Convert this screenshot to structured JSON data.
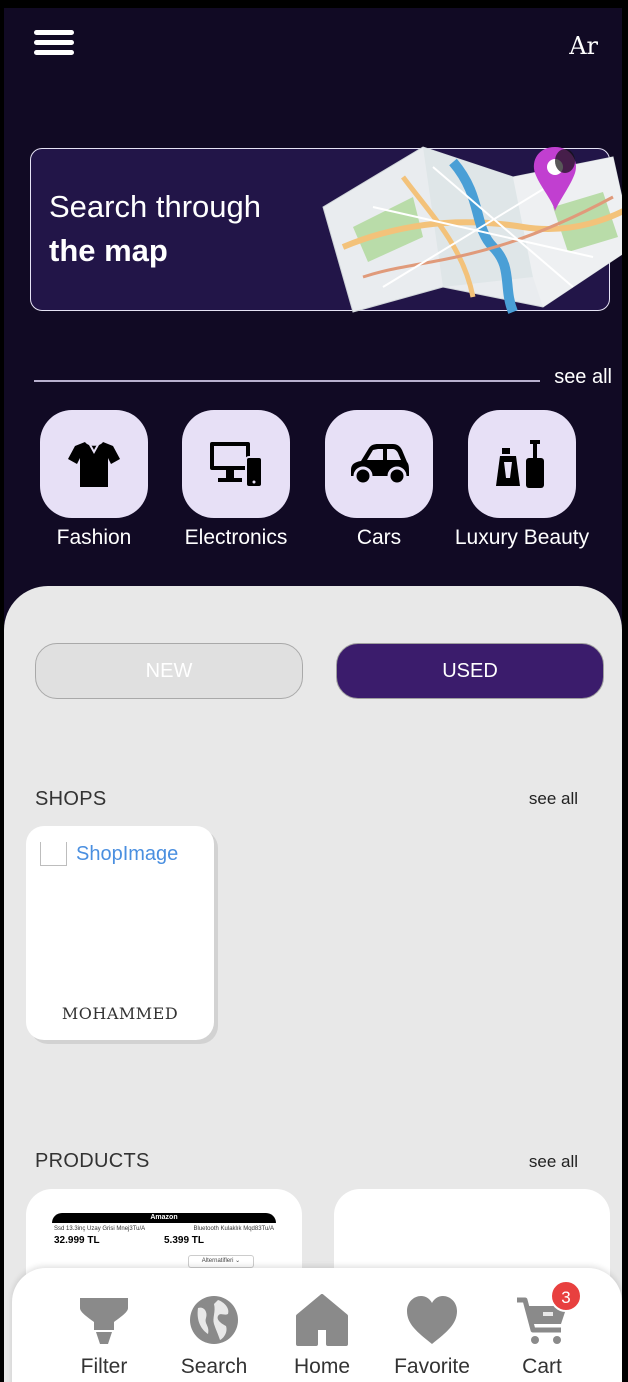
{
  "header": {
    "language_label": "Ar"
  },
  "map_banner": {
    "line1": "Search through",
    "line2": "the map"
  },
  "categories": {
    "see_all": "see all",
    "items": [
      {
        "label": "Fashion",
        "icon": "shirt-icon"
      },
      {
        "label": "Electronics",
        "icon": "devices-icon"
      },
      {
        "label": "Cars",
        "icon": "car-icon"
      },
      {
        "label": "Luxury Beauty",
        "icon": "perfume-icon"
      }
    ]
  },
  "condition_toggle": {
    "new_label": "NEW",
    "used_label": "USED",
    "selected": "USED"
  },
  "shops": {
    "title": "SHOPS",
    "see_all": "see all",
    "items": [
      {
        "image_alt": "ShopImage",
        "name": "MOHAMMED"
      }
    ]
  },
  "products": {
    "title": "PRODUCTS",
    "see_all": "see all",
    "items": [
      {
        "thumb_header": "Amazon",
        "thumb_name_1": "Ssd 13.3inç Uzay Grisi Mnej3Tu/A",
        "thumb_name_2": "Bluetooth Kulaklık Mqd83Tu/A",
        "thumb_price_1": "32.999 TL",
        "thumb_price_2": "5.399 TL",
        "thumb_select": "Alternatifleri"
      },
      {}
    ]
  },
  "bottom_nav": {
    "items": [
      {
        "label": "Filter",
        "icon": "filter-icon"
      },
      {
        "label": "Search",
        "icon": "globe-icon"
      },
      {
        "label": "Home",
        "icon": "home-icon"
      },
      {
        "label": "Favorite",
        "icon": "heart-icon"
      },
      {
        "label": "Cart",
        "icon": "cart-icon"
      }
    ],
    "cart_count": "3"
  },
  "colors": {
    "background": "#110a24",
    "banner": "#221548",
    "accent": "#3b1c6c",
    "category_tile": "#e7e0f6",
    "sheet": "#e8e8e8",
    "badge": "#e8403f"
  }
}
